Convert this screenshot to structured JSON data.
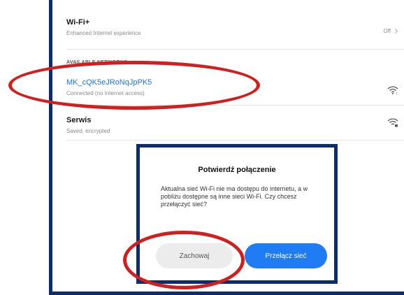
{
  "settings": {
    "wifiplus": {
      "title": "Wi-Fi+",
      "subtitle": "Enhanced Internet experience",
      "status": "Off"
    },
    "section_header": "AVAILABLE NETWORKS",
    "networks": [
      {
        "ssid": "MK_cQK5eJRoNqJpPK5",
        "status": "Connected (no Internet access)",
        "icon": "wifi-no-internet-icon"
      },
      {
        "ssid": "Serwis",
        "status": "Saved, encrypted",
        "icon": "wifi-locked-icon"
      }
    ]
  },
  "dialog": {
    "title": "Potwierdź połączenie",
    "body": "Aktualna sieć Wi-Fi nie ma dostępu do internetu, a w pobliżu dostępne są inne sieci Wi-Fi. Czy chcesz przełączyć sieć?",
    "keep_label": "Zachowaj",
    "switch_label": "Przełącz sieć"
  },
  "colors": {
    "frame": "#0d2c6b",
    "annotation": "#d11f1f",
    "accent": "#1f7cf3",
    "link": "#1a73e8"
  }
}
